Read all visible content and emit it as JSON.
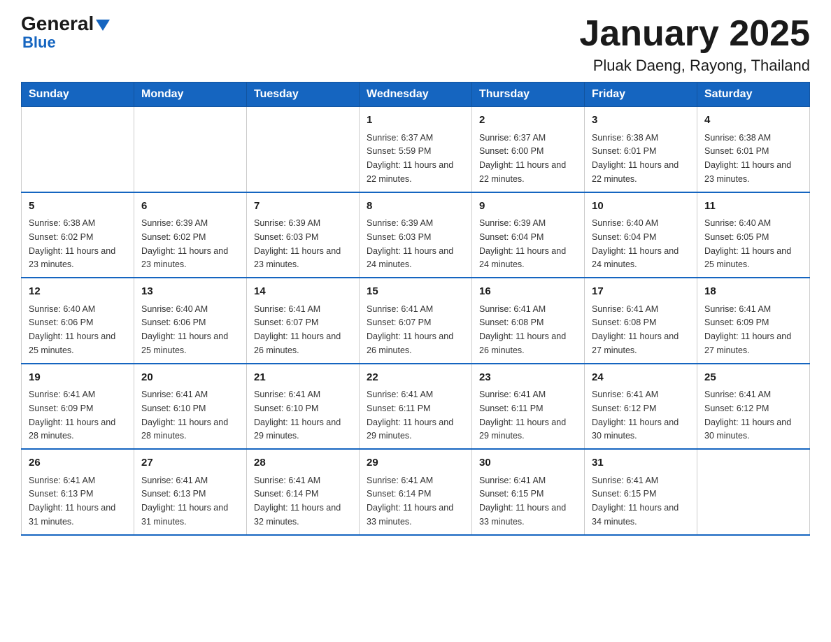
{
  "logo": {
    "general": "General",
    "triangle_icon": "triangle",
    "blue": "Blue"
  },
  "header": {
    "title": "January 2025",
    "location": "Pluak Daeng, Rayong, Thailand"
  },
  "days_of_week": [
    "Sunday",
    "Monday",
    "Tuesday",
    "Wednesday",
    "Thursday",
    "Friday",
    "Saturday"
  ],
  "weeks": [
    [
      {
        "day": "",
        "sunrise": "",
        "sunset": "",
        "daylight": ""
      },
      {
        "day": "",
        "sunrise": "",
        "sunset": "",
        "daylight": ""
      },
      {
        "day": "",
        "sunrise": "",
        "sunset": "",
        "daylight": ""
      },
      {
        "day": "1",
        "sunrise": "Sunrise: 6:37 AM",
        "sunset": "Sunset: 5:59 PM",
        "daylight": "Daylight: 11 hours and 22 minutes."
      },
      {
        "day": "2",
        "sunrise": "Sunrise: 6:37 AM",
        "sunset": "Sunset: 6:00 PM",
        "daylight": "Daylight: 11 hours and 22 minutes."
      },
      {
        "day": "3",
        "sunrise": "Sunrise: 6:38 AM",
        "sunset": "Sunset: 6:01 PM",
        "daylight": "Daylight: 11 hours and 22 minutes."
      },
      {
        "day": "4",
        "sunrise": "Sunrise: 6:38 AM",
        "sunset": "Sunset: 6:01 PM",
        "daylight": "Daylight: 11 hours and 23 minutes."
      }
    ],
    [
      {
        "day": "5",
        "sunrise": "Sunrise: 6:38 AM",
        "sunset": "Sunset: 6:02 PM",
        "daylight": "Daylight: 11 hours and 23 minutes."
      },
      {
        "day": "6",
        "sunrise": "Sunrise: 6:39 AM",
        "sunset": "Sunset: 6:02 PM",
        "daylight": "Daylight: 11 hours and 23 minutes."
      },
      {
        "day": "7",
        "sunrise": "Sunrise: 6:39 AM",
        "sunset": "Sunset: 6:03 PM",
        "daylight": "Daylight: 11 hours and 23 minutes."
      },
      {
        "day": "8",
        "sunrise": "Sunrise: 6:39 AM",
        "sunset": "Sunset: 6:03 PM",
        "daylight": "Daylight: 11 hours and 24 minutes."
      },
      {
        "day": "9",
        "sunrise": "Sunrise: 6:39 AM",
        "sunset": "Sunset: 6:04 PM",
        "daylight": "Daylight: 11 hours and 24 minutes."
      },
      {
        "day": "10",
        "sunrise": "Sunrise: 6:40 AM",
        "sunset": "Sunset: 6:04 PM",
        "daylight": "Daylight: 11 hours and 24 minutes."
      },
      {
        "day": "11",
        "sunrise": "Sunrise: 6:40 AM",
        "sunset": "Sunset: 6:05 PM",
        "daylight": "Daylight: 11 hours and 25 minutes."
      }
    ],
    [
      {
        "day": "12",
        "sunrise": "Sunrise: 6:40 AM",
        "sunset": "Sunset: 6:06 PM",
        "daylight": "Daylight: 11 hours and 25 minutes."
      },
      {
        "day": "13",
        "sunrise": "Sunrise: 6:40 AM",
        "sunset": "Sunset: 6:06 PM",
        "daylight": "Daylight: 11 hours and 25 minutes."
      },
      {
        "day": "14",
        "sunrise": "Sunrise: 6:41 AM",
        "sunset": "Sunset: 6:07 PM",
        "daylight": "Daylight: 11 hours and 26 minutes."
      },
      {
        "day": "15",
        "sunrise": "Sunrise: 6:41 AM",
        "sunset": "Sunset: 6:07 PM",
        "daylight": "Daylight: 11 hours and 26 minutes."
      },
      {
        "day": "16",
        "sunrise": "Sunrise: 6:41 AM",
        "sunset": "Sunset: 6:08 PM",
        "daylight": "Daylight: 11 hours and 26 minutes."
      },
      {
        "day": "17",
        "sunrise": "Sunrise: 6:41 AM",
        "sunset": "Sunset: 6:08 PM",
        "daylight": "Daylight: 11 hours and 27 minutes."
      },
      {
        "day": "18",
        "sunrise": "Sunrise: 6:41 AM",
        "sunset": "Sunset: 6:09 PM",
        "daylight": "Daylight: 11 hours and 27 minutes."
      }
    ],
    [
      {
        "day": "19",
        "sunrise": "Sunrise: 6:41 AM",
        "sunset": "Sunset: 6:09 PM",
        "daylight": "Daylight: 11 hours and 28 minutes."
      },
      {
        "day": "20",
        "sunrise": "Sunrise: 6:41 AM",
        "sunset": "Sunset: 6:10 PM",
        "daylight": "Daylight: 11 hours and 28 minutes."
      },
      {
        "day": "21",
        "sunrise": "Sunrise: 6:41 AM",
        "sunset": "Sunset: 6:10 PM",
        "daylight": "Daylight: 11 hours and 29 minutes."
      },
      {
        "day": "22",
        "sunrise": "Sunrise: 6:41 AM",
        "sunset": "Sunset: 6:11 PM",
        "daylight": "Daylight: 11 hours and 29 minutes."
      },
      {
        "day": "23",
        "sunrise": "Sunrise: 6:41 AM",
        "sunset": "Sunset: 6:11 PM",
        "daylight": "Daylight: 11 hours and 29 minutes."
      },
      {
        "day": "24",
        "sunrise": "Sunrise: 6:41 AM",
        "sunset": "Sunset: 6:12 PM",
        "daylight": "Daylight: 11 hours and 30 minutes."
      },
      {
        "day": "25",
        "sunrise": "Sunrise: 6:41 AM",
        "sunset": "Sunset: 6:12 PM",
        "daylight": "Daylight: 11 hours and 30 minutes."
      }
    ],
    [
      {
        "day": "26",
        "sunrise": "Sunrise: 6:41 AM",
        "sunset": "Sunset: 6:13 PM",
        "daylight": "Daylight: 11 hours and 31 minutes."
      },
      {
        "day": "27",
        "sunrise": "Sunrise: 6:41 AM",
        "sunset": "Sunset: 6:13 PM",
        "daylight": "Daylight: 11 hours and 31 minutes."
      },
      {
        "day": "28",
        "sunrise": "Sunrise: 6:41 AM",
        "sunset": "Sunset: 6:14 PM",
        "daylight": "Daylight: 11 hours and 32 minutes."
      },
      {
        "day": "29",
        "sunrise": "Sunrise: 6:41 AM",
        "sunset": "Sunset: 6:14 PM",
        "daylight": "Daylight: 11 hours and 33 minutes."
      },
      {
        "day": "30",
        "sunrise": "Sunrise: 6:41 AM",
        "sunset": "Sunset: 6:15 PM",
        "daylight": "Daylight: 11 hours and 33 minutes."
      },
      {
        "day": "31",
        "sunrise": "Sunrise: 6:41 AM",
        "sunset": "Sunset: 6:15 PM",
        "daylight": "Daylight: 11 hours and 34 minutes."
      },
      {
        "day": "",
        "sunrise": "",
        "sunset": "",
        "daylight": ""
      }
    ]
  ]
}
